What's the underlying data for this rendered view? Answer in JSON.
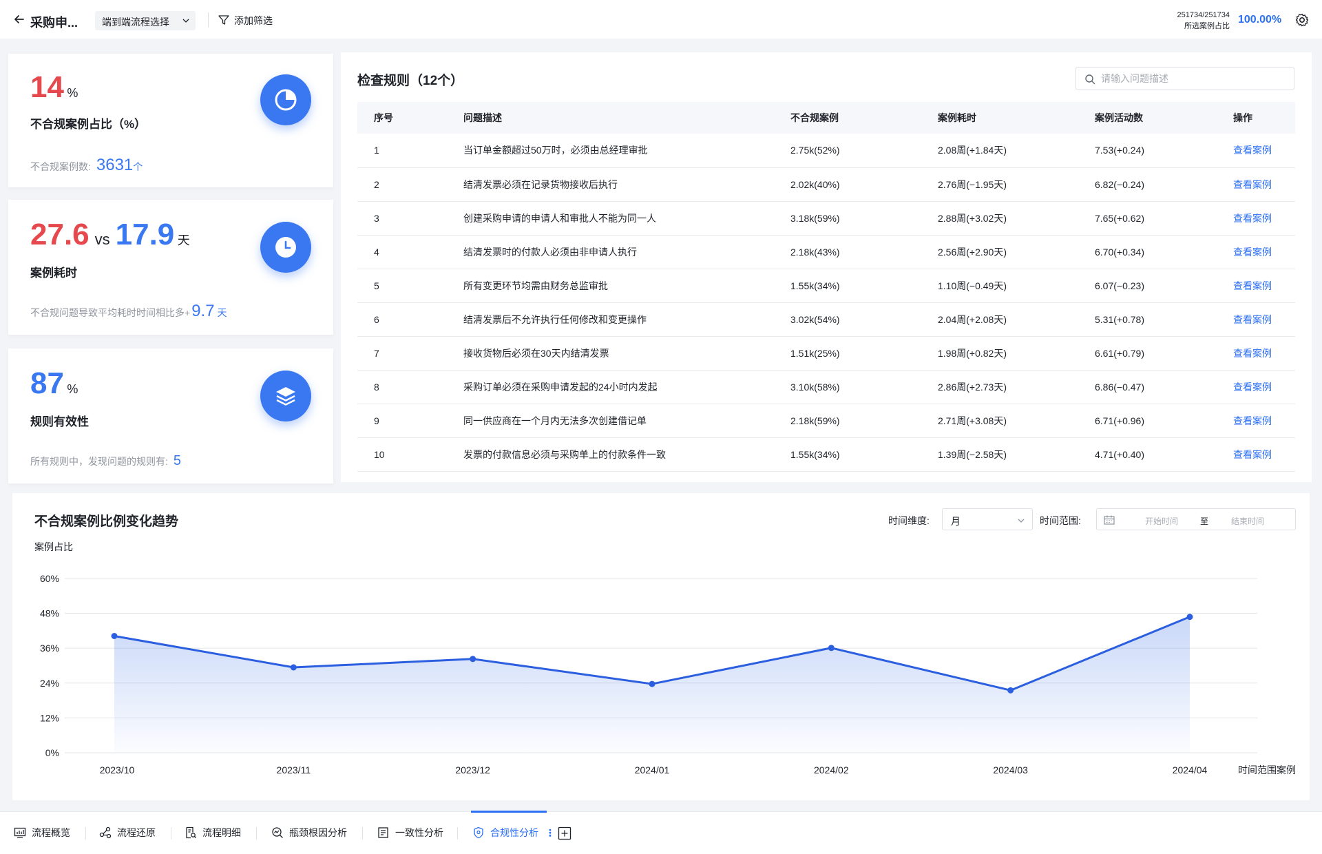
{
  "header": {
    "title": "采购申...",
    "flow_select": "端到端流程选择",
    "filter_label": "添加筛选",
    "case_count": "251734/251734",
    "case_ratio_label": "所选案例占比",
    "case_ratio": "100.00%"
  },
  "kpis": {
    "noncompliance": {
      "value": "14",
      "unit": "%",
      "label": "不合规案例占比（%）",
      "foot_label": "不合规案例数:",
      "foot_value": "3631",
      "foot_unit": "个"
    },
    "duration": {
      "value_a": "27.6",
      "vs": "vs",
      "value_b": "17.9",
      "unit": "天",
      "label": "案例耗时",
      "foot_label": "不合规问题导致平均耗时时间相比多+",
      "foot_value": "9.7",
      "foot_unit": "天"
    },
    "effectiveness": {
      "value": "87",
      "unit": "%",
      "label": "规则有效性",
      "foot_label": "所有规则中，发现问题的规则有:",
      "foot_value": "5"
    }
  },
  "rules": {
    "title": "检查规则（12个）",
    "search_placeholder": "请输入问题描述",
    "columns": [
      "序号",
      "问题描述",
      "不合规案例",
      "案例耗时",
      "案例活动数",
      "操作"
    ],
    "rows": [
      [
        "1",
        "当订单金额超过50万时，必须由总经理审批",
        "2.75k(52%)",
        "2.08周(+1.84天)",
        "7.53(+0.24)",
        "查看案例"
      ],
      [
        "2",
        "结清发票必须在记录货物接收后执行",
        "2.02k(40%)",
        "2.76周(−1.95天)",
        "6.82(−0.24)",
        "查看案例"
      ],
      [
        "3",
        "创建采购申请的申请人和审批人不能为同一人",
        "3.18k(59%)",
        "2.88周(+3.02天)",
        "7.65(+0.62)",
        "查看案例"
      ],
      [
        "4",
        "结清发票时的付款人必须由非申请人执行",
        "2.18k(43%)",
        "2.56周(+2.90天)",
        "6.70(+0.34)",
        "查看案例"
      ],
      [
        "5",
        "所有变更环节均需由财务总监审批",
        "1.55k(34%)",
        "1.10周(−0.49天)",
        "6.07(−0.23)",
        "查看案例"
      ],
      [
        "6",
        "结清发票后不允许执行任何修改和变更操作",
        "3.02k(54%)",
        "2.04周(+2.08天)",
        "5.31(+0.78)",
        "查看案例"
      ],
      [
        "7",
        "接收货物后必须在30天内结清发票",
        "1.51k(25%)",
        "1.98周(+0.82天)",
        "6.61(+0.79)",
        "查看案例"
      ],
      [
        "8",
        "采购订单必须在采购申请发起的24小时内发起",
        "3.10k(58%)",
        "2.86周(+2.73天)",
        "6.86(−0.47)",
        "查看案例"
      ],
      [
        "9",
        "同一供应商在一个月内无法多次创建借记单",
        "2.18k(59%)",
        "2.71周(+3.08天)",
        "6.71(+0.96)",
        "查看案例"
      ],
      [
        "10",
        "发票的付款信息必须与采购单上的付款条件一致",
        "1.55k(34%)",
        "1.39周(−2.58天)",
        "4.71(+0.40)",
        "查看案例"
      ]
    ]
  },
  "trend": {
    "title": "不合规案例比例变化趋势",
    "dimension_label": "时间维度:",
    "dimension_value": "月",
    "range_label": "时间范围:",
    "range_start": "开始时间",
    "range_to": "至",
    "range_end": "结束时间"
  },
  "chart_data": {
    "type": "area",
    "ylabel": "案例占比",
    "xlabel": "时间范围案例",
    "categories": [
      "2023/10",
      "2023/11",
      "2023/12",
      "2024/01",
      "2024/02",
      "2024/03",
      "2024/04"
    ],
    "values": [
      40.2,
      29.4,
      32.3,
      23.7,
      36.1,
      21.5,
      46.8
    ],
    "yticks": [
      "0%",
      "12%",
      "24%",
      "36%",
      "48%",
      "60%"
    ],
    "ylim": [
      0,
      60
    ],
    "grid": true,
    "color": "#2b5fe0"
  },
  "tabs": [
    {
      "label": "流程概览",
      "icon": "chart-bar-icon"
    },
    {
      "label": "流程还原",
      "icon": "flow-nodes-icon"
    },
    {
      "label": "流程明细",
      "icon": "document-search-icon"
    },
    {
      "label": "瓶颈根因分析",
      "icon": "magnify-chart-icon"
    },
    {
      "label": "一致性分析",
      "icon": "list-doc-icon"
    },
    {
      "label": "合规性分析",
      "icon": "shield-icon"
    }
  ],
  "colors": {
    "accent": "#2b6ff2",
    "danger": "#e5484d"
  }
}
